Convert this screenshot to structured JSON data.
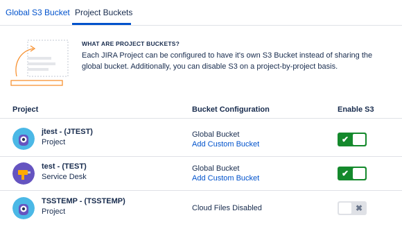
{
  "tabs": [
    {
      "label": "Global S3 Bucket"
    },
    {
      "label": "Project Buckets"
    }
  ],
  "intro": {
    "title": "WHAT ARE PROJECT BUCKETS?",
    "text": "Each JIRA Project can be configured to have it's own S3 Bucket instead of sharing the global bucket. Additionally, you can  disable S3 on a project-by-project basis."
  },
  "table": {
    "headers": [
      "Project",
      "Bucket Configuration",
      "Enable S3"
    ],
    "rows": [
      {
        "name": "jtest - (JTEST)",
        "type": "Project",
        "bucket": "Global Bucket",
        "link": "Add Custom Bucket",
        "enabled": true,
        "toggle_glyph": "✔"
      },
      {
        "name": "test - (TEST)",
        "type": "Service Desk",
        "bucket": "Global Bucket",
        "link": "Add Custom Bucket",
        "enabled": true,
        "toggle_glyph": "✔"
      },
      {
        "name": "TSSTEMP - (TSSTEMP)",
        "type": "Project",
        "bucket": "Cloud Files Disabled",
        "link": "",
        "enabled": false,
        "toggle_glyph": "✖"
      }
    ]
  },
  "colors": {
    "accent": "#0052cc",
    "toggle_on": "#14892c",
    "toggle_off": "#dfe1e6",
    "illustration": "#f79232"
  }
}
